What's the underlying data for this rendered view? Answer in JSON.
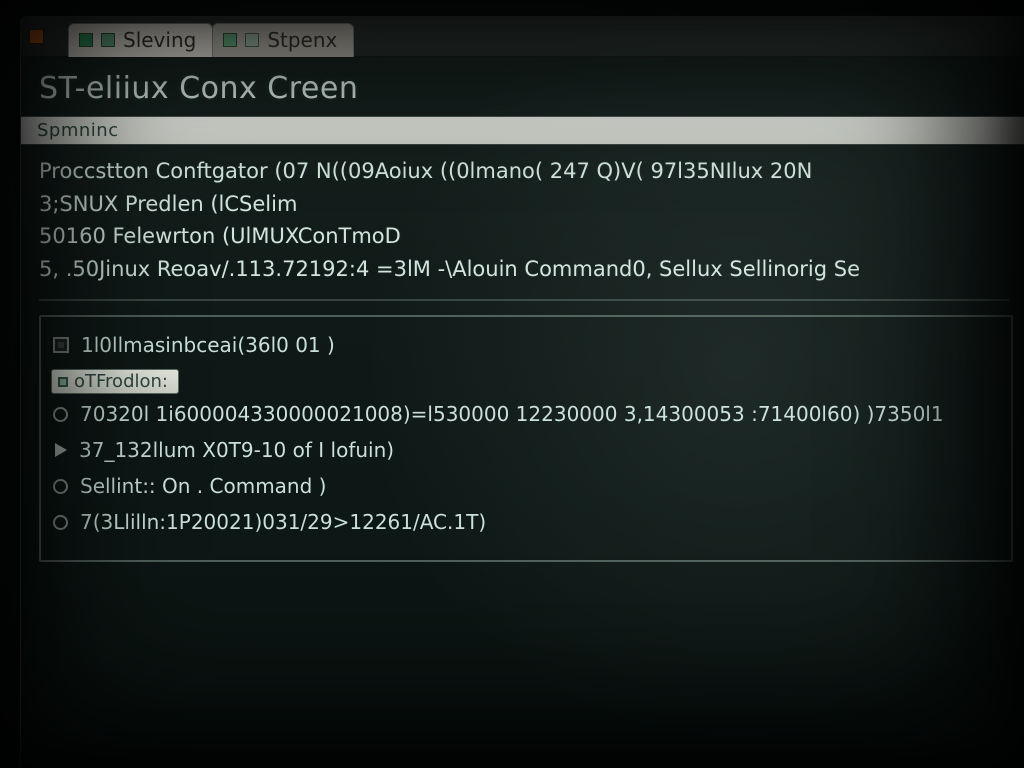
{
  "tabs": {
    "active_label": "Sleving",
    "inactive_label": "Stpenx"
  },
  "header": {
    "title": "ST-eliiux Conx Creen"
  },
  "subbar": {
    "label": "Spmninc"
  },
  "lines": {
    "l1": "Proccstton Conftgator (07 N((09Aoiux ((0lmano( 247 Q)V( 97l35NIlux 20N",
    "l2": "3;SNUX Predlen (lCSelim",
    "l3": "50160 Felewrton (UlMUXConTmoD",
    "l4": "5, .50Jinux Reoav/.113.72192:4 =3lM -\\Alouin Command0, Sellux Sellinorig Se"
  },
  "panel": {
    "header": "1l0llmasinbceai(36l0 01 )",
    "chip": "oTFrodlon:",
    "row1": "70320l 1i600004330000021008)=l530000 12230000 3,14300053 :71400l60)    )7350l1",
    "row2": "37_132llum X0T9-10 of I lofuin)",
    "row3": "Sellint:: On . Command )",
    "row4": "7(3Llilln:1P20021)031/29>12261/AC.1T)"
  },
  "icons": {
    "close": "close-icon",
    "tab_active": "tab-icon",
    "tab_inactive": "tab-icon"
  }
}
